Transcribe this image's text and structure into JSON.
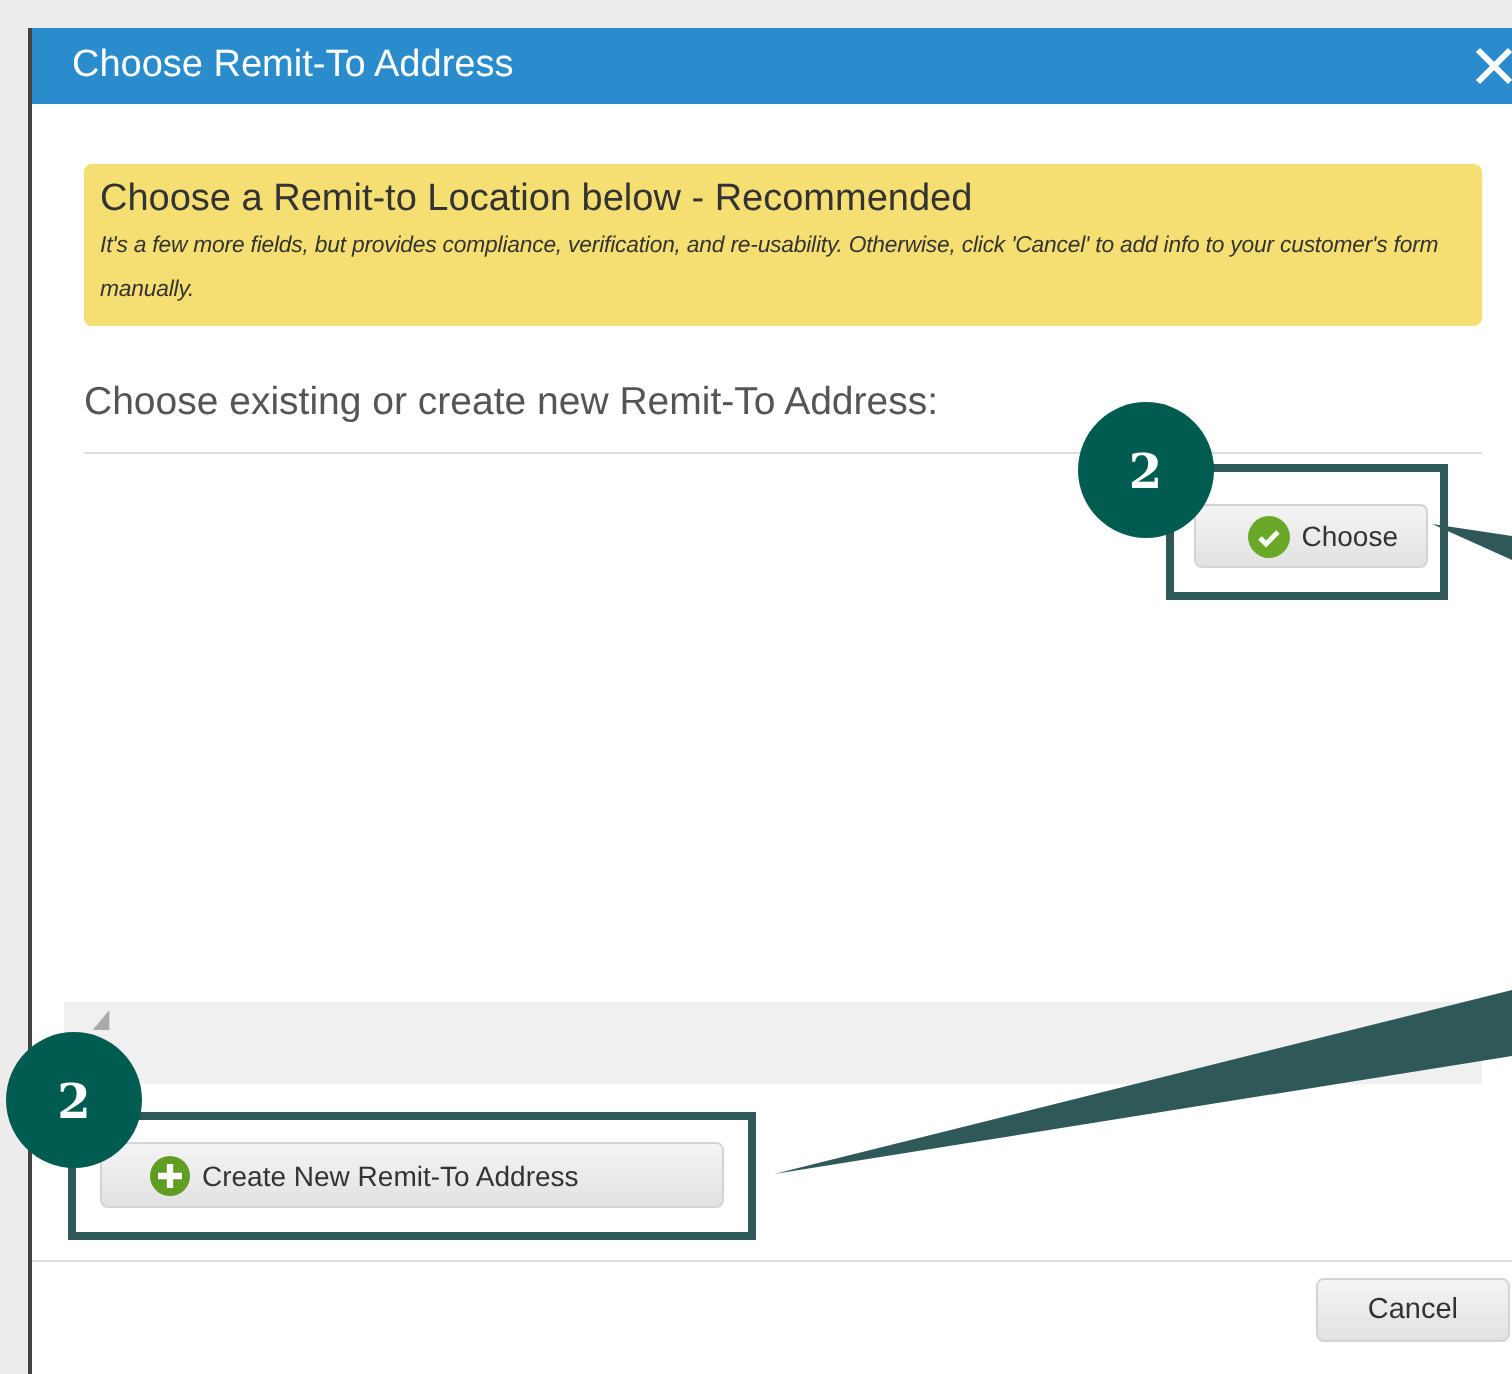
{
  "dialog": {
    "title": "Choose Remit-To Address"
  },
  "banner": {
    "heading": "Choose a Remit-to Location below - Recommended",
    "text": "It's a few more fields, but provides compliance, verification, and re-usability. Otherwise, click 'Cancel' to add info to your customer's form manually."
  },
  "prompt": "Choose existing or create new Remit-To Address:",
  "choose_button": {
    "label": "Choose",
    "badge": "2"
  },
  "create_button": {
    "label": "Create New Remit-To Address",
    "badge": "2"
  },
  "cancel_button": {
    "label": "Cancel"
  }
}
